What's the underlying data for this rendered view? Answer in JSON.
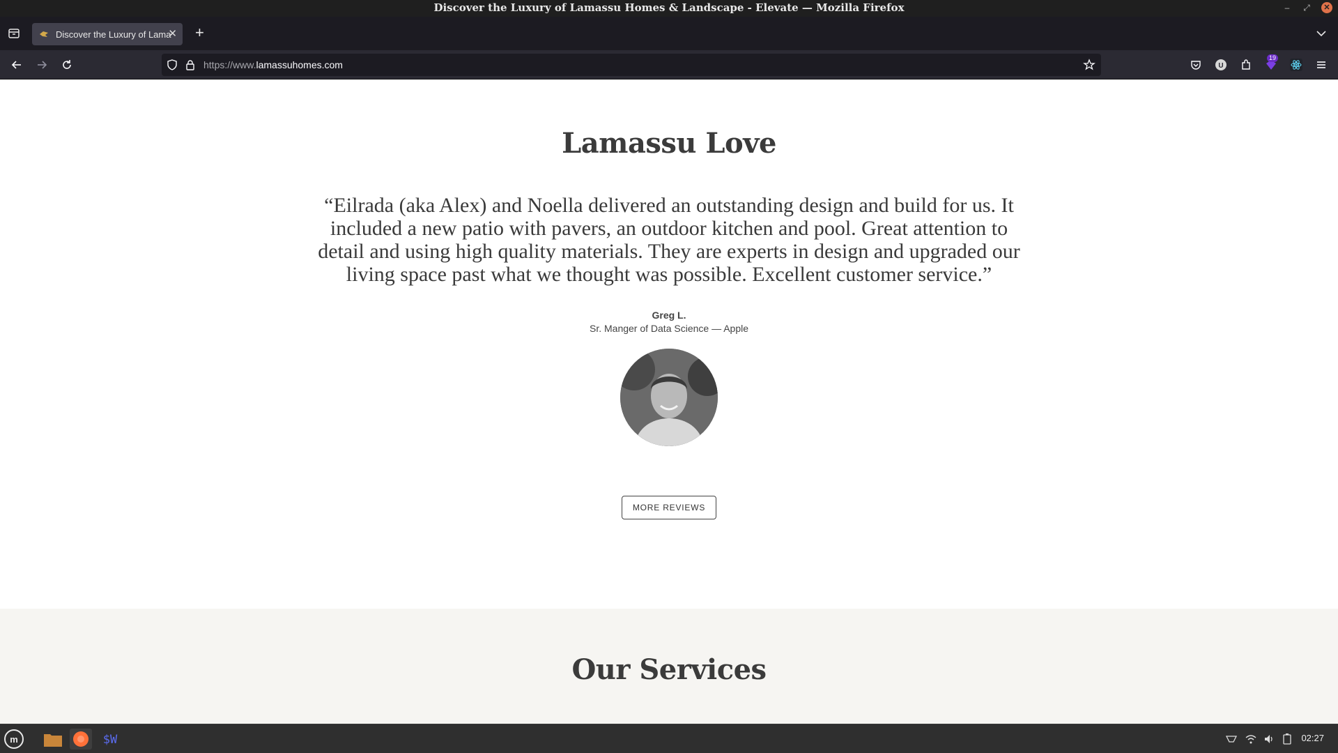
{
  "window": {
    "title": "Discover the Luxury of Lamassu Homes & Landscape - Elevate — Mozilla Firefox"
  },
  "tabs": [
    {
      "label": "Discover the Luxury of Lamassu Homes & Landscape - Elevate",
      "active": true
    }
  ],
  "navbar": {
    "url_prefix": "https://www.",
    "url_domain": "lamassuhomes.com",
    "extension_badge": "19"
  },
  "testimonial": {
    "section_title": "Lamassu Love",
    "quote": "“Eilrada (aka Alex) and Noella delivered an outstanding design and build for us. It included a new patio with pavers, an outdoor kitchen and pool. Great attention to detail and using high quality materials. They are experts in design and upgraded our living space past what we thought was possible. Excellent customer service.”",
    "author": "Greg L.",
    "role": "Sr. Manger of Data Science — Apple",
    "more_button": "MORE REVIEWS"
  },
  "services": {
    "section_title": "Our Services"
  },
  "taskbar": {
    "clock": "02:27",
    "apps": [
      "menu-icon",
      "files-icon",
      "firefox-icon",
      "terminal-icon"
    ]
  },
  "colors": {
    "titlebar": "#1f1f1f",
    "tabstrip": "#1c1b22",
    "navbar": "#2b2a33",
    "services_bg": "#f6f5f2",
    "taskbar": "#2f2f2f"
  }
}
